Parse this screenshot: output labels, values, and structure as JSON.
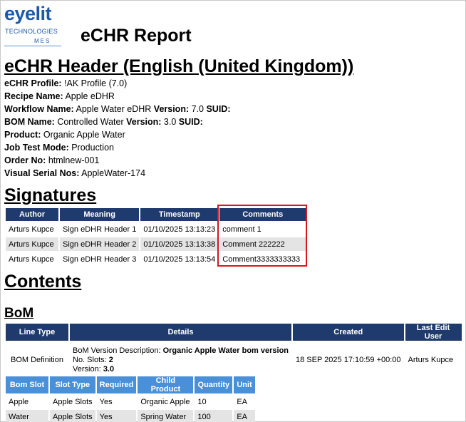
{
  "logo": {
    "main": "eyelit",
    "technologies": "TECHNOLOGIES",
    "mes": "MES"
  },
  "report_title": "eCHR Report",
  "header_title": "eCHR Header (English (United Kingdom))",
  "info": {
    "profile_label": "eCHR Profile:",
    "profile_value": " !AK Profile (7.0)",
    "recipe_label": "Recipe Name:",
    "recipe_value": " Apple eDHR",
    "workflow_label": "Workflow Name:",
    "workflow_value": " Apple Water eDHR ",
    "workflow_version_label": "Version:",
    "workflow_version_value": " 7.0 ",
    "workflow_suid_label": "SUID:",
    "bom_label": "BOM Name:",
    "bom_value": " Controlled Water ",
    "bom_version_label": "Version:",
    "bom_version_value": " 3.0 ",
    "bom_suid_label": "SUID:",
    "product_label": "Product:",
    "product_value": " Organic Apple Water",
    "jobtest_label": "Job Test Mode:",
    "jobtest_value": " Production",
    "order_label": "Order No:",
    "order_value": " htmlnew-001",
    "serial_label": "Visual Serial Nos:",
    "serial_value": " AppleWater-174"
  },
  "signatures": {
    "title": "Signatures",
    "columns": [
      "Author",
      "Meaning",
      "Timestamp",
      "Comments"
    ],
    "rows": [
      {
        "author": "Arturs Kupce",
        "meaning": "Sign eDHR Header 1",
        "timestamp": "01/10/2025 13:13:23",
        "comment": "comment 1"
      },
      {
        "author": "Arturs Kupce",
        "meaning": "Sign eDHR Header 2",
        "timestamp": "01/10/2025 13:13:38",
        "comment": "Comment 222222"
      },
      {
        "author": "Arturs Kupce",
        "meaning": "Sign eDHR Header 3",
        "timestamp": "01/10/2025 13:13:54",
        "comment": "Comment3333333333"
      }
    ]
  },
  "contents_title": "Contents",
  "bom": {
    "title": "BoM",
    "columns": [
      "Line Type",
      "Details",
      "Created",
      "Last Edit User"
    ],
    "row": {
      "line_type": "BOM Definition",
      "desc_label": "BoM Version Description: ",
      "desc_value": "Organic Apple Water bom version",
      "slots_label": "No. Slots: ",
      "slots_value": "2",
      "version_label": "Version: ",
      "version_value": "3.0",
      "created": "18 SEP 2025 17:10:59 +00:00",
      "last_edit_user": "Arturs Kupce"
    },
    "slot_columns": [
      "Bom Slot",
      "Slot Type",
      "Required",
      "Child Product",
      "Quantity",
      "Unit"
    ],
    "slots": [
      {
        "slot": "Apple",
        "type": "Apple Slots",
        "required": "Yes",
        "child": "Organic Apple",
        "qty": "10",
        "unit": "EA"
      },
      {
        "slot": "Water",
        "type": "Apple Slots",
        "required": "Yes",
        "child": "Spring Water",
        "qty": "100",
        "unit": "EA"
      }
    ]
  },
  "colors": {
    "header_navy": "#1f3b6e",
    "slot_header_blue": "#4a90d9",
    "highlight_red": "#d9141b",
    "logo_blue": "#1c5aa8"
  }
}
